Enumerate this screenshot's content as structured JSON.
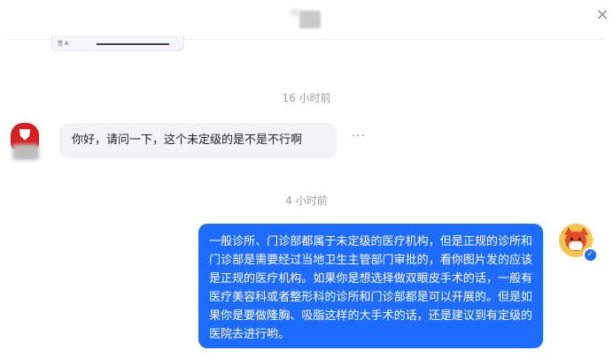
{
  "window": {
    "close_glyph": "✕"
  },
  "previous_card": {
    "label": "签 A:"
  },
  "timestamps": [
    "16 小时前",
    "4 小时前"
  ],
  "messages": [
    {
      "side": "left",
      "text": "你好，请问一下，这个未定级的是不是不行啊",
      "more_glyph": "···"
    },
    {
      "side": "right",
      "text": "一般诊所、门诊部都属于未定级的医疗机构，但是正规的诊所和门诊部是需要经过当地卫生主管部门审批的，看你图片发的应该是正规的医疗机构。如果你是想选择做双眼皮手术的话，一般有医疗美容科或者整形科的诊所和门诊部都是可以开展的。但是如果你是要做隆胸、吸脂这样的大手术的话，还是建议到有定级的医院去进行哟。"
    }
  ],
  "icons": {
    "left_avatar": "red-brand-avatar",
    "right_avatar": "fox-avatar",
    "badge": "verified-check-icon"
  },
  "colors": {
    "accent_blue": "#1e6bff",
    "left_bubble_bg": "#f2f3f5",
    "timestamp": "#9aa0a6"
  }
}
